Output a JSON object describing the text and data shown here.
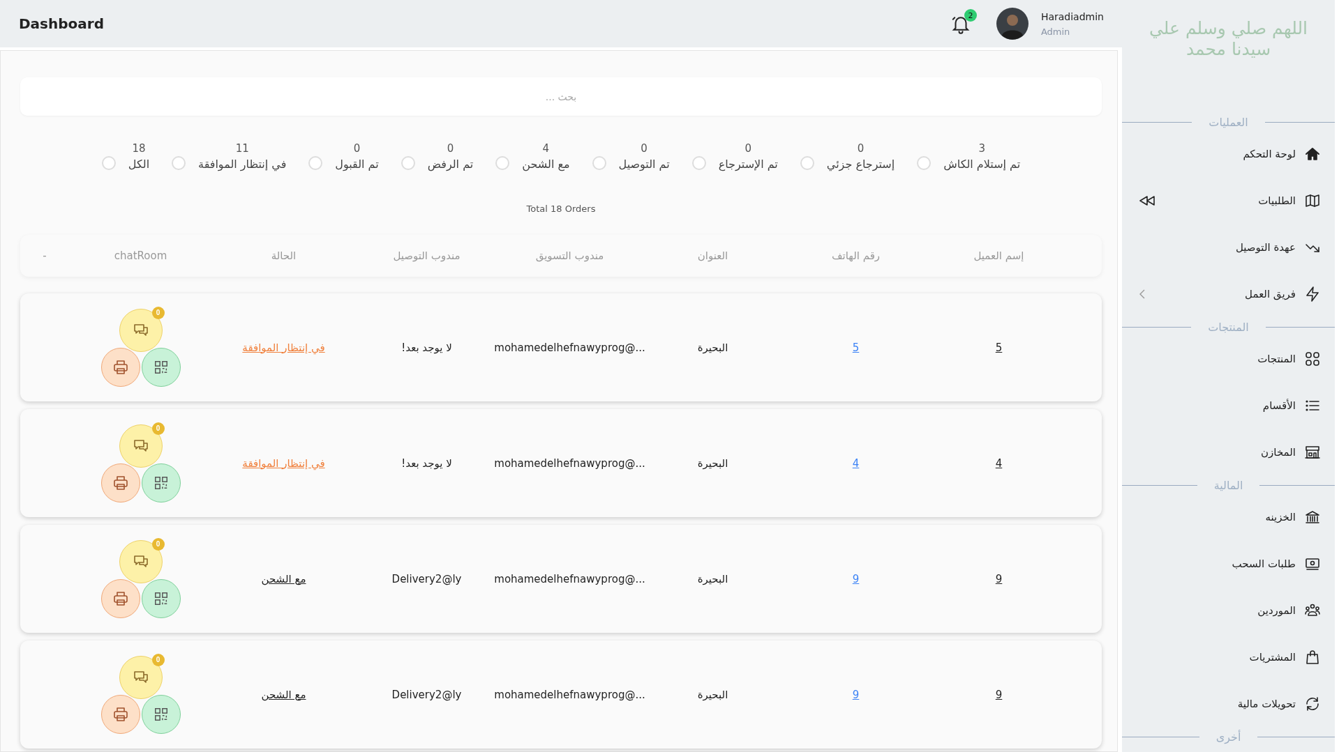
{
  "header": {
    "title": "Dashboard",
    "notifications": "2",
    "user": {
      "name": "Haradiadmin",
      "role": "Admin"
    }
  },
  "search": {
    "placeholder": "بحث ..."
  },
  "filters": [
    {
      "label": "تم إستلام الكاش",
      "count": "3",
      "selected": false
    },
    {
      "label": "إسترجاع جزئي",
      "count": "0",
      "selected": false
    },
    {
      "label": "تم الإسترجاع",
      "count": "0",
      "selected": false
    },
    {
      "label": "تم التوصيل",
      "count": "0",
      "selected": false
    },
    {
      "label": "مع الشحن",
      "count": "4",
      "selected": false
    },
    {
      "label": "تم الرفض",
      "count": "0",
      "selected": false
    },
    {
      "label": "تم القبول",
      "count": "0",
      "selected": false
    },
    {
      "label": "في إنتظار الموافقة",
      "count": "11",
      "selected": false
    },
    {
      "label": "الكل",
      "count": "18",
      "selected": false
    }
  ],
  "total": "Total 18 Orders",
  "table": {
    "columns": [
      "إسم العميل",
      "رقم الهاتف",
      "العنوان",
      "مندوب التسويق",
      "مندوب التوصيل",
      "الحالة",
      "chatRoom",
      "-"
    ],
    "rows": [
      {
        "customer": "5",
        "phone": "5",
        "address": "البحيرة",
        "marketer": "mohamedelhefnawyprog@...",
        "courier": "لا يوجد بعد!",
        "status": {
          "text": "في إنتظار الموافقة",
          "kind": "pending"
        },
        "chat_count": "0"
      },
      {
        "customer": "4",
        "phone": "4",
        "address": "البحيرة",
        "marketer": "mohamedelhefnawyprog@...",
        "courier": "لا يوجد بعد!",
        "status": {
          "text": "في إنتظار الموافقة",
          "kind": "pending"
        },
        "chat_count": "0"
      },
      {
        "customer": "9",
        "phone": "9",
        "address": "البحيرة",
        "marketer": "mohamedelhefnawyprog@...",
        "courier": "Delivery2@ly",
        "status": {
          "text": "مع الشحن",
          "kind": "shipping"
        },
        "chat_count": "0"
      },
      {
        "customer": "9",
        "phone": "9",
        "address": "البحيرة",
        "marketer": "mohamedelhefnawyprog@...",
        "courier": "Delivery2@ly",
        "status": {
          "text": "مع الشحن",
          "kind": "shipping"
        },
        "chat_count": "0"
      }
    ]
  },
  "sidebar": {
    "blessing": "اللهم صلي وسلم علي سيدنا محمد",
    "sections": [
      {
        "title": "العمليات",
        "items": [
          {
            "label": "لوحة التحكم",
            "kind": "home"
          },
          {
            "label": "الطلبيات",
            "kind": "map",
            "collapse_toggle": true
          },
          {
            "label": "عهدة التوصيل",
            "kind": "trend"
          },
          {
            "label": "فريق العمل",
            "kind": "bolt",
            "has_submenu": true
          }
        ]
      },
      {
        "title": "المنتجات",
        "items": [
          {
            "label": "المنتجات",
            "kind": "grid"
          },
          {
            "label": "الأقسام",
            "kind": "list"
          },
          {
            "label": "المخازن",
            "kind": "store"
          }
        ]
      },
      {
        "title": "المالية",
        "items": [
          {
            "label": "الخزينه",
            "kind": "bank"
          },
          {
            "label": "طلبات السحب",
            "kind": "money"
          },
          {
            "label": "الموردين",
            "kind": "people"
          },
          {
            "label": "المشتريات",
            "kind": "bag"
          },
          {
            "label": "تحويلات مالية",
            "kind": "refresh"
          }
        ]
      },
      {
        "title": "أخرى"
      }
    ]
  }
}
